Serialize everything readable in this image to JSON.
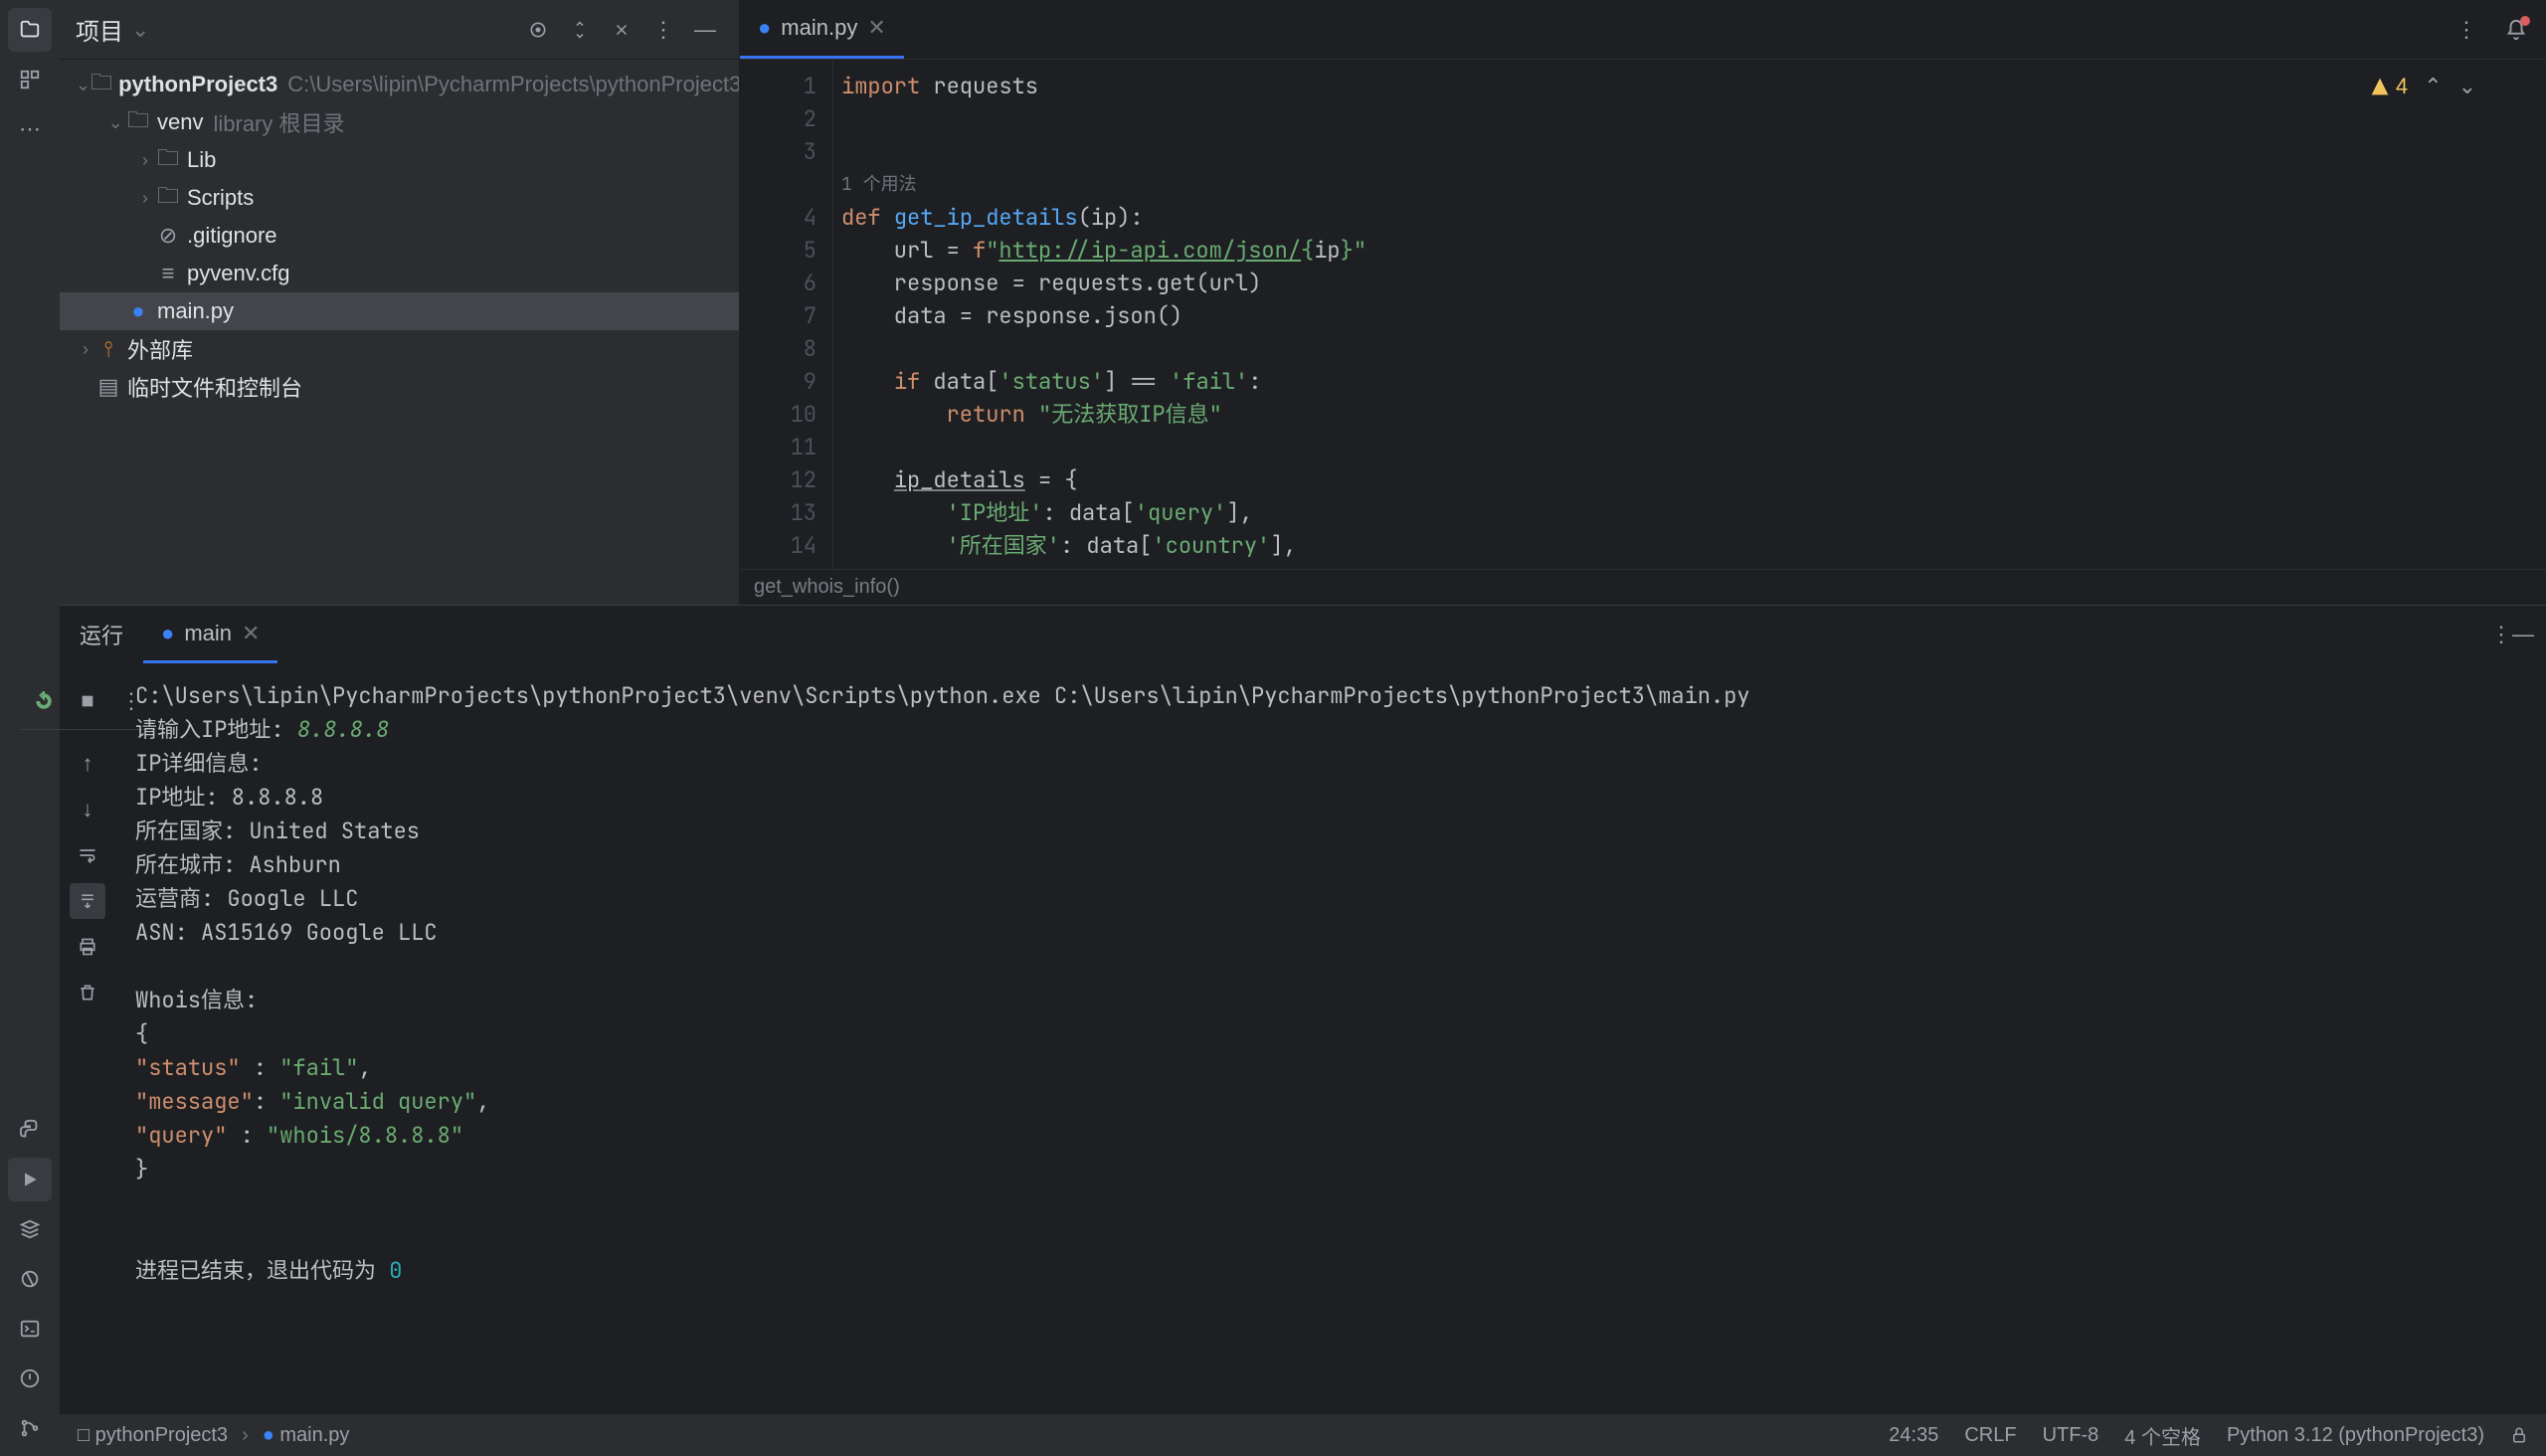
{
  "panel": {
    "title": "项目",
    "root_name": "pythonProject3",
    "root_path": "C:\\Users\\lipin\\PycharmProjects\\pythonProject3",
    "venv": "venv",
    "venv_hint": "library 根目录",
    "lib": "Lib",
    "scripts": "Scripts",
    "gitignore": ".gitignore",
    "pyvenv": "pyvenv.cfg",
    "mainpy": "main.py",
    "external": "外部库",
    "scratch": "临时文件和控制台"
  },
  "editor": {
    "tab_name": "main.py",
    "warning_count": "4",
    "usage_hint": "1 个用法",
    "breadcrumb": "get_whois_info()",
    "lines": [
      "import requests",
      "",
      "",
      "def get_ip_details(ip):",
      "    url = f\"http://ip-api.com/json/{ip}\"",
      "    response = requests.get(url)",
      "    data = response.json()",
      "",
      "    if data['status'] == 'fail':",
      "        return \"无法获取IP信息\"",
      "",
      "    ip_details = {",
      "        'IP地址': data['query'],",
      "        '所在国家': data['country'],"
    ]
  },
  "run": {
    "label": "运行",
    "tab_name": "main",
    "cmd": "C:\\Users\\lipin\\PycharmProjects\\pythonProject3\\venv\\Scripts\\python.exe C:\\Users\\lipin\\PycharmProjects\\pythonProject3\\main.py",
    "prompt_label": "请输入IP地址: ",
    "prompt_input": "8.8.8.8",
    "l_header": "IP详细信息:",
    "l_ip": "IP地址: 8.8.8.8",
    "l_country": "所在国家: United States",
    "l_city": "所在城市: Ashburn",
    "l_isp": "运营商: Google LLC",
    "l_asn": "ASN: AS15169 Google LLC",
    "l_whois": "Whois信息:",
    "json_open": "{",
    "json_status_k": "\"status\"",
    "json_status_v": "\"fail\"",
    "json_message_k": "\"message\"",
    "json_message_v": "\"invalid query\"",
    "json_query_k": "\"query\"",
    "json_query_v": "\"whois/8.8.8.8\"",
    "json_close": "}",
    "exit_prefix": "进程已结束，退出代码为 ",
    "exit_code": "0"
  },
  "status": {
    "proj": "pythonProject3",
    "file": "main.py",
    "pos": "24:35",
    "eol": "CRLF",
    "enc": "UTF-8",
    "indent": "4 个空格",
    "interp": "Python 3.12 (pythonProject3)"
  }
}
